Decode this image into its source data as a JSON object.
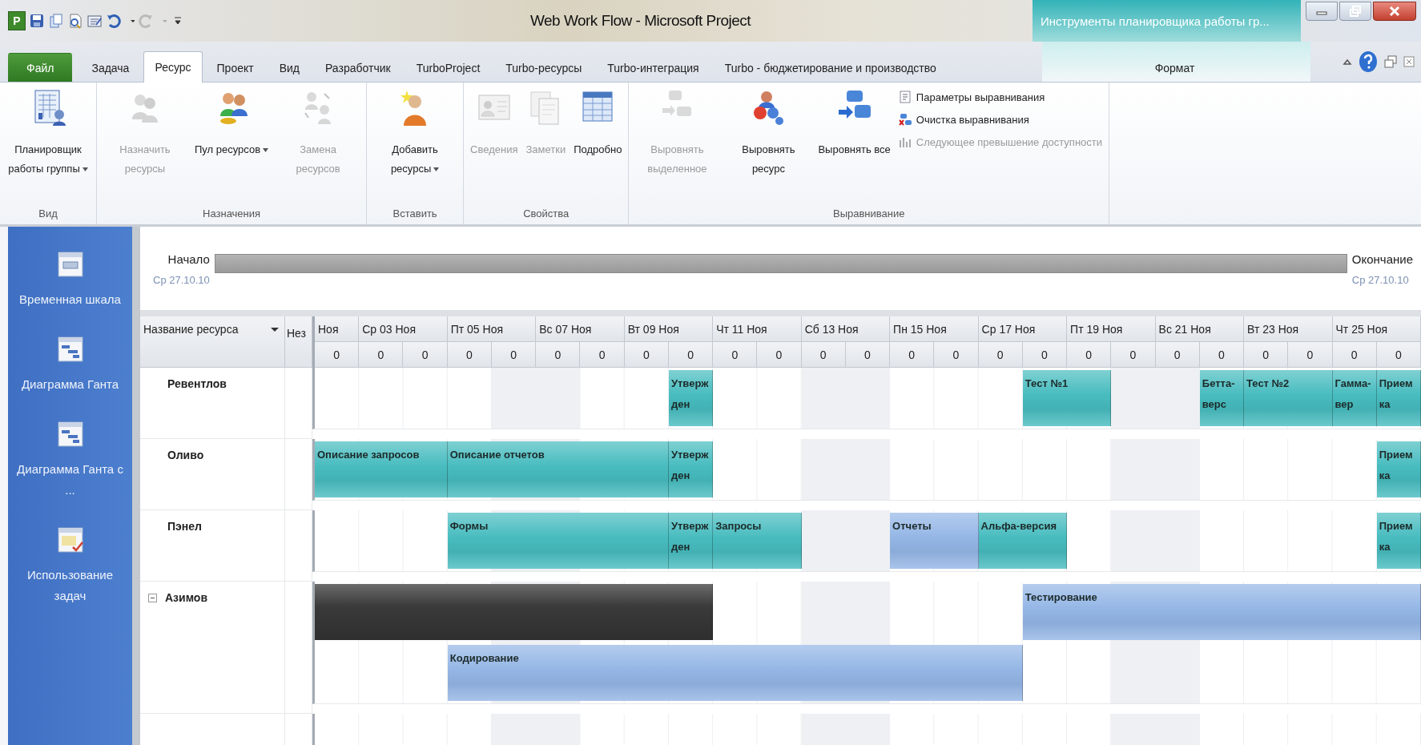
{
  "window": {
    "app_icon": "P",
    "title": "Web Work Flow - Microsoft Project",
    "context_title": "Инструменты планировщика работы гр..."
  },
  "tabs": [
    {
      "label": "Файл",
      "kind": "file",
      "selected": false
    },
    {
      "label": "Задача",
      "kind": "normal",
      "selected": false
    },
    {
      "label": "Ресурс",
      "kind": "normal",
      "selected": true
    },
    {
      "label": "Проект",
      "kind": "normal",
      "selected": false
    },
    {
      "label": "Вид",
      "kind": "normal",
      "selected": false
    },
    {
      "label": "Разработчик",
      "kind": "normal",
      "selected": false
    },
    {
      "label": "TurboProject",
      "kind": "normal",
      "selected": false
    },
    {
      "label": "Turbo-ресурсы",
      "kind": "normal",
      "selected": false
    },
    {
      "label": "Turbo-интеграция",
      "kind": "normal",
      "selected": false
    },
    {
      "label": "Turbo - бюджетирование и производство",
      "kind": "normal",
      "selected": false
    },
    {
      "label": "Формат",
      "kind": "context",
      "selected": false
    }
  ],
  "ribbon": {
    "groups": [
      {
        "label": "Вид",
        "buttons": [
          {
            "label": "Планировщик работы группы",
            "kind": "large",
            "dropdown": true,
            "disabled": false
          }
        ]
      },
      {
        "label": "Назначения",
        "buttons": [
          {
            "label": "Назначить ресурсы",
            "kind": "large",
            "dropdown": false,
            "disabled": true
          },
          {
            "label": "Пул ресурсов",
            "kind": "large",
            "dropdown": true,
            "disabled": false
          },
          {
            "label": "Замена ресурсов",
            "kind": "large",
            "dropdown": false,
            "disabled": true
          }
        ]
      },
      {
        "label": "Вставить",
        "buttons": [
          {
            "label": "Добавить ресурсы",
            "kind": "large",
            "dropdown": true,
            "disabled": false
          }
        ]
      },
      {
        "label": "Свойства",
        "buttons": [
          {
            "label": "Сведения",
            "kind": "large",
            "dropdown": false,
            "disabled": true
          },
          {
            "label": "Заметки",
            "kind": "large",
            "dropdown": false,
            "disabled": true
          },
          {
            "label": "Подробно",
            "kind": "large",
            "dropdown": false,
            "disabled": false
          }
        ]
      },
      {
        "label": "Выравнивание",
        "buttons": [
          {
            "label": "Выровнять выделенное",
            "kind": "large",
            "dropdown": false,
            "disabled": true
          },
          {
            "label": "Выровнять ресурс",
            "kind": "large",
            "dropdown": false,
            "disabled": false
          },
          {
            "label": "Выровнять все",
            "kind": "large",
            "dropdown": false,
            "disabled": false
          },
          {
            "label": "Параметры выравнивания",
            "kind": "small",
            "dropdown": false,
            "disabled": false
          },
          {
            "label": "Очистка выравнивания",
            "kind": "small",
            "dropdown": false,
            "disabled": false
          },
          {
            "label": "Следующее превышение доступности",
            "kind": "small",
            "dropdown": false,
            "disabled": true
          }
        ]
      }
    ]
  },
  "sidebar": {
    "items": [
      {
        "label": "Временная шкала"
      },
      {
        "label": "Диаграмма Ганта"
      },
      {
        "label": "Диаграмма Ганта с ..."
      },
      {
        "label": "Использование задач"
      }
    ]
  },
  "timeline": {
    "start_label": "Начало",
    "start_date": "Ср 27.10.10",
    "finish_label": "Окончание",
    "finish_date": "Ср 27.10.10"
  },
  "grid": {
    "columns": [
      "Название ресурса",
      "Нез"
    ],
    "timescale": [
      {
        "date_label": "Ноя",
        "value": "0",
        "weekend": false
      },
      {
        "date_label": "Ср 03 Ноя",
        "value": "0",
        "weekend": false
      },
      {
        "value": "0",
        "weekend": false
      },
      {
        "date_label": "Пт 05 Ноя",
        "value": "0",
        "weekend": false
      },
      {
        "value": "0",
        "weekend": true
      },
      {
        "date_label": "Вс 07 Ноя",
        "value": "0",
        "weekend": true
      },
      {
        "value": "0",
        "weekend": false
      },
      {
        "date_label": "Вт 09 Ноя",
        "value": "0",
        "weekend": false
      },
      {
        "value": "0",
        "weekend": false
      },
      {
        "date_label": "Чт 11 Ноя",
        "value": "0",
        "weekend": false
      },
      {
        "value": "0",
        "weekend": false
      },
      {
        "date_label": "Сб 13 Ноя",
        "value": "0",
        "weekend": true
      },
      {
        "value": "0",
        "weekend": true
      },
      {
        "date_label": "Пн 15 Ноя",
        "value": "0",
        "weekend": false
      },
      {
        "value": "0",
        "weekend": false
      },
      {
        "date_label": "Ср 17 Ноя",
        "value": "0",
        "weekend": false
      },
      {
        "value": "0",
        "weekend": false
      },
      {
        "date_label": "Пт 19 Ноя",
        "value": "0",
        "weekend": false
      },
      {
        "value": "0",
        "weekend": true
      },
      {
        "date_label": "Вс 21 Ноя",
        "value": "0",
        "weekend": true
      },
      {
        "value": "0",
        "weekend": false
      },
      {
        "date_label": "Вт 23 Ноя",
        "value": "0",
        "weekend": false
      },
      {
        "value": "0",
        "weekend": false
      },
      {
        "date_label": "Чт 25 Ноя",
        "value": "0",
        "weekend": false
      },
      {
        "value": "0",
        "weekend": false
      }
    ],
    "resources": [
      {
        "name": "Ревентлов",
        "lanes": [
          {
            "cells": [
              {
                "kind": "empty"
              },
              {
                "kind": "empty"
              },
              {
                "kind": "empty"
              },
              {
                "kind": "empty"
              },
              {
                "kind": "empty"
              },
              {
                "kind": "empty"
              },
              {
                "kind": "empty"
              },
              {
                "kind": "empty"
              },
              {
                "kind": "task",
                "label": "Утвержден",
                "color": "#47bcbf"
              },
              {
                "kind": "empty"
              },
              {
                "kind": "empty"
              },
              {
                "kind": "empty"
              },
              {
                "kind": "empty"
              },
              {
                "kind": "empty"
              },
              {
                "kind": "empty"
              },
              {
                "kind": "empty"
              },
              {
                "kind": "task",
                "label": "Тест №1",
                "color": "#47bcbf"
              },
              {
                "kind": "more"
              },
              {
                "kind": "empty"
              },
              {
                "kind": "empty"
              },
              {
                "kind": "task",
                "label": "Бетта-верс",
                "color": "#47bcbf"
              },
              {
                "kind": "task",
                "label": "Тест №2",
                "color": "#47bcbf"
              },
              {
                "kind": "more"
              },
              {
                "kind": "task",
                "label": "Гамма-вер",
                "color": "#47bcbf"
              },
              {
                "kind": "task",
                "label": "Приемка",
                "color": "#47bcbf"
              }
            ]
          }
        ]
      },
      {
        "name": "Оливо",
        "lanes": [
          {
            "cells": [
              {
                "kind": "task",
                "label": "Описание запросов",
                "color": "#47bcbf"
              },
              {
                "kind": "more"
              },
              {
                "kind": "more"
              },
              {
                "kind": "task",
                "label": "Описание отчетов",
                "color": "#47bcbf"
              },
              {
                "kind": "more"
              },
              {
                "kind": "more"
              },
              {
                "kind": "more"
              },
              {
                "kind": "more"
              },
              {
                "kind": "task",
                "label": "Утвержден",
                "color": "#47bcbf"
              },
              {
                "kind": "empty"
              },
              {
                "kind": "empty"
              },
              {
                "kind": "empty"
              },
              {
                "kind": "empty"
              },
              {
                "kind": "empty"
              },
              {
                "kind": "empty"
              },
              {
                "kind": "empty"
              },
              {
                "kind": "empty"
              },
              {
                "kind": "empty"
              },
              {
                "kind": "empty"
              },
              {
                "kind": "empty"
              },
              {
                "kind": "empty"
              },
              {
                "kind": "empty"
              },
              {
                "kind": "empty"
              },
              {
                "kind": "empty"
              },
              {
                "kind": "task",
                "label": "Приемка",
                "color": "#47bcbf"
              }
            ]
          }
        ]
      },
      {
        "name": "Пэнел",
        "lanes": [
          {
            "cells": [
              {
                "kind": "empty"
              },
              {
                "kind": "empty"
              },
              {
                "kind": "empty"
              },
              {
                "kind": "task",
                "label": "Формы",
                "color": "#47bcbf"
              },
              {
                "kind": "more"
              },
              {
                "kind": "more"
              },
              {
                "kind": "more"
              },
              {
                "kind": "more"
              },
              {
                "kind": "task",
                "label": "Утвержден",
                "color": "#47bcbf"
              },
              {
                "kind": "task",
                "label": "Запросы",
                "color": "#47bcbf"
              },
              {
                "kind": "more"
              },
              {
                "kind": "empty"
              },
              {
                "kind": "empty"
              },
              {
                "kind": "task",
                "label": "Отчеты",
                "color": "#94b6e6"
              },
              {
                "kind": "more"
              },
              {
                "kind": "task",
                "label": "Альфа-версия",
                "color": "#47bcbf"
              },
              {
                "kind": "more"
              },
              {
                "kind": "empty"
              },
              {
                "kind": "empty"
              },
              {
                "kind": "empty"
              },
              {
                "kind": "empty"
              },
              {
                "kind": "empty"
              },
              {
                "kind": "empty"
              },
              {
                "kind": "empty"
              },
              {
                "kind": "task",
                "label": "Приемка",
                "color": "#47bcbf"
              }
            ]
          }
        ]
      },
      {
        "name": "Азимов",
        "expanded": true,
        "lanes": [
          {
            "cells": [
              {
                "kind": "summary",
                "color": "#3a3a3a"
              },
              {
                "kind": "more"
              },
              {
                "kind": "more"
              },
              {
                "kind": "more"
              },
              {
                "kind": "more"
              },
              {
                "kind": "more"
              },
              {
                "kind": "more"
              },
              {
                "kind": "more"
              },
              {
                "kind": "more"
              },
              {
                "kind": "empty"
              },
              {
                "kind": "empty"
              },
              {
                "kind": "empty"
              },
              {
                "kind": "empty"
              },
              {
                "kind": "empty"
              },
              {
                "kind": "empty"
              },
              {
                "kind": "empty"
              },
              {
                "kind": "task",
                "label": "Тестирование",
                "color": "#94b6e6"
              },
              {
                "kind": "more"
              },
              {
                "kind": "more"
              },
              {
                "kind": "more"
              },
              {
                "kind": "more"
              },
              {
                "kind": "more"
              },
              {
                "kind": "more"
              },
              {
                "kind": "more"
              },
              {
                "kind": "more"
              }
            ]
          },
          {
            "cells": [
              {
                "kind": "empty"
              },
              {
                "kind": "empty"
              },
              {
                "kind": "empty"
              },
              {
                "kind": "task",
                "label": "Кодирование",
                "color": "#94b6e6"
              },
              {
                "kind": "more"
              },
              {
                "kind": "more"
              },
              {
                "kind": "more"
              },
              {
                "kind": "more"
              },
              {
                "kind": "more"
              },
              {
                "kind": "more"
              },
              {
                "kind": "more"
              },
              {
                "kind": "more"
              },
              {
                "kind": "more"
              },
              {
                "kind": "more"
              },
              {
                "kind": "more"
              },
              {
                "kind": "more"
              },
              {
                "kind": "empty"
              },
              {
                "kind": "empty"
              },
              {
                "kind": "empty"
              },
              {
                "kind": "empty"
              },
              {
                "kind": "empty"
              },
              {
                "kind": "empty"
              },
              {
                "kind": "empty"
              },
              {
                "kind": "empty"
              },
              {
                "kind": "empty"
              }
            ]
          }
        ]
      }
    ]
  }
}
